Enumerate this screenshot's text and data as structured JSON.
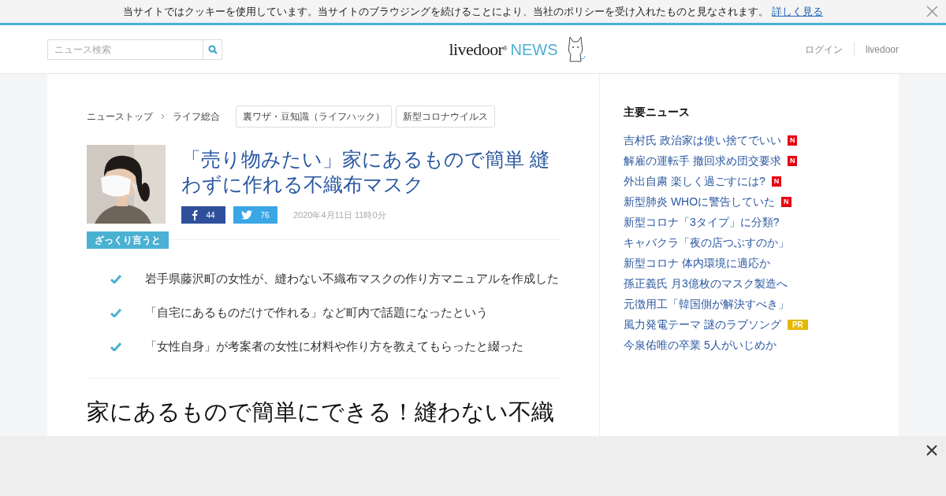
{
  "cookie_bar": {
    "text": "当サイトではクッキーを使用しています。当サイトのブラウジングを続けることにより、当社のポリシーを受け入れたものと見なされます。",
    "link": "詳しく見る"
  },
  "header": {
    "search": {
      "placeholder": "ニュース検索"
    },
    "logo": {
      "word": "livedoor",
      "mark": "®",
      "news": "NEWS"
    },
    "links": [
      "ログイン",
      "livedoor"
    ]
  },
  "breadcrumb": [
    "ニューストップ",
    "ライフ総合"
  ],
  "tags": [
    "裏ワザ・豆知識（ライフハック）",
    "新型コロナウイルス"
  ],
  "article": {
    "title": "「売り物みたい」家にあるもので簡単 縫わずに作れる不織布マスク",
    "share": [
      {
        "kind": "facebook",
        "count": "44"
      },
      {
        "kind": "twitter",
        "count": "76"
      }
    ],
    "date": "2020年4月11日 11時0分",
    "summary_label": "ざっくり言うと",
    "summary": [
      "岩手県藤沢町の女性が、縫わない不織布マスクの作り方マニュアルを作成した",
      "「自宅にあるものだけで作れる」など町内で話題になったという",
      "「女性自身」が考案者の女性に材料や作り方を教えてもらったと綴った"
    ],
    "heading": "家にあるもので簡単にできる！縫わない不織"
  },
  "sidebar": {
    "title": "主要ニュース",
    "items": [
      {
        "text": "吉村氏 政治家は使い捨てでいい",
        "badge": {
          "kind": "new",
          "label": "N"
        }
      },
      {
        "text": "解雇の運転手 撤回求め団交要求",
        "badge": {
          "kind": "new",
          "label": "N"
        }
      },
      {
        "text": "外出自粛 楽しく過ごすには?",
        "badge": {
          "kind": "new",
          "label": "N"
        }
      },
      {
        "text": "新型肺炎 WHOに警告していた",
        "badge": {
          "kind": "new",
          "label": "N"
        }
      },
      {
        "text": "新型コロナ「3タイプ」に分類?"
      },
      {
        "text": "キャバクラ「夜の店つぶすのか」"
      },
      {
        "text": "新型コロナ 体内環境に適応か"
      },
      {
        "text": "孫正義氏 月3億枚のマスク製造へ"
      },
      {
        "text": "元徴用工「韓国側が解決すべき」"
      },
      {
        "text": "風力発電テーマ 謎のラブソング",
        "badge": {
          "kind": "pr",
          "label": "PR"
        }
      },
      {
        "text": "今泉佑唯の卒業 5人がいじめか"
      }
    ]
  }
}
